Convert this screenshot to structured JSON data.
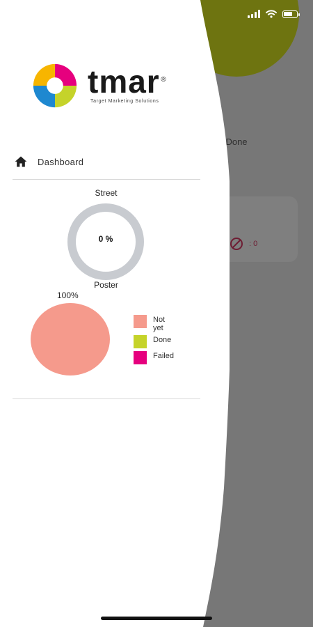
{
  "app": {
    "logo_word": "tmar",
    "logo_reg": "®",
    "logo_tagline": "Target Marketing Solutions"
  },
  "drawer": {
    "nav_items": [
      {
        "label": "Dashboard",
        "icon": "home-icon"
      }
    ]
  },
  "street_chart": {
    "title": "Street",
    "value_label": "0 %"
  },
  "poster_chart": {
    "title": "Poster",
    "top_label": "100%",
    "legend": [
      {
        "label": "Not yet",
        "color": "#f59a8c"
      },
      {
        "label": "Done",
        "color": "#c5d32a"
      },
      {
        "label": "Failed",
        "color": "#e6007e"
      }
    ]
  },
  "chart_data": [
    {
      "type": "pie",
      "title": "Street",
      "categories": [
        "Done"
      ],
      "values": [
        0
      ],
      "center_label": "0 %",
      "ring_color": "#c8cbd0"
    },
    {
      "type": "pie",
      "title": "Poster",
      "categories": [
        "Not yet",
        "Done",
        "Failed"
      ],
      "values": [
        100,
        0,
        0
      ],
      "colors": [
        "#f59a8c",
        "#c5d32a",
        "#e6007e"
      ],
      "data_labels": [
        "100%"
      ],
      "legend_position": "right"
    }
  ],
  "background_screen": {
    "status_text": "ot Done",
    "failed_count": ": 0",
    "accent_color": "#6e7410",
    "failed_icon": "prohibited-icon"
  },
  "status_bar": {
    "icons": [
      "signal-icon",
      "wifi-icon",
      "battery-icon"
    ]
  }
}
